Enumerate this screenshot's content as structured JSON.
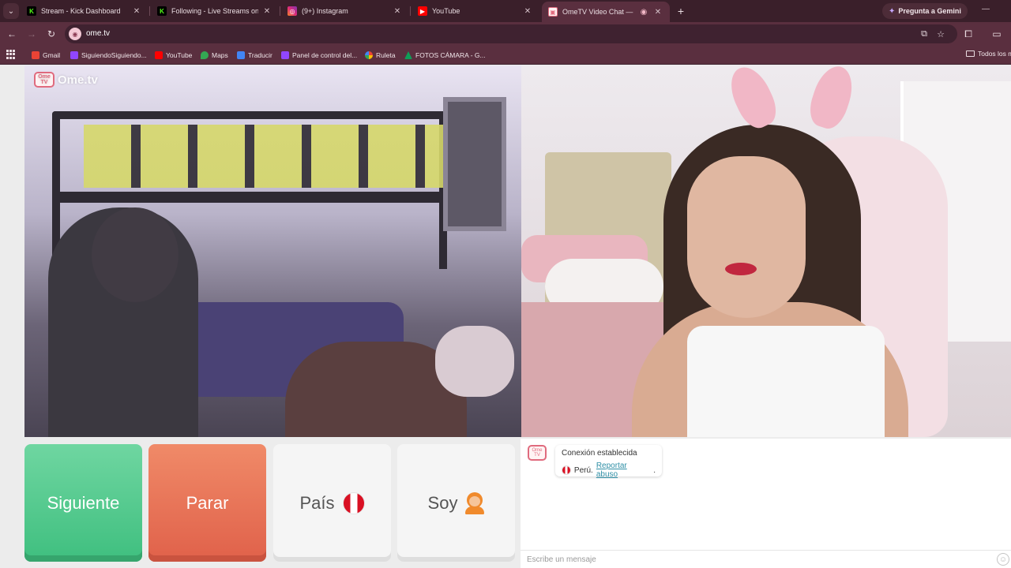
{
  "browser": {
    "tabs": [
      {
        "title": "Stream - Kick Dashboard",
        "favicon": "kick-icon",
        "color": "#53fc18",
        "active": false
      },
      {
        "title": "Following - Live Streams on Kic",
        "favicon": "kick-icon",
        "color": "#53fc18",
        "active": false
      },
      {
        "title": "(9+) Instagram",
        "favicon": "instagram-icon",
        "color": "#e1306c",
        "active": false
      },
      {
        "title": "YouTube",
        "favicon": "youtube-icon",
        "color": "#ff0000",
        "active": false
      },
      {
        "title": "OmeTV Video Chat — Ome",
        "favicon": "ometv-icon",
        "color": "#e06b7e",
        "active": true
      }
    ],
    "new_tab_glyph": "+",
    "gemini_label": "Pregunta a Gemini",
    "url": "ome.tv",
    "bookmarks": [
      {
        "label": "Gmail",
        "color": "#ea4335"
      },
      {
        "label": "SiguiendoSiguiendo...",
        "color": "#9146ff"
      },
      {
        "label": "YouTube",
        "color": "#ff0000"
      },
      {
        "label": "Maps",
        "color": "#34a853"
      },
      {
        "label": "Traducir",
        "color": "#4285f4"
      },
      {
        "label": "Panel de control del...",
        "color": "#9146ff"
      },
      {
        "label": "Ruleta",
        "color": "#fbbc05"
      },
      {
        "label": "FOTOS CÁMARA - G...",
        "color": "#0f9d58"
      }
    ],
    "all_bookmarks_label": "Todos los m"
  },
  "app": {
    "logo_text": "Ome.tv",
    "logo_badge": "Ome TV",
    "accent_color": "#e06b7e"
  },
  "controls": {
    "next_label": "Siguiente",
    "stop_label": "Parar",
    "country_label": "País",
    "country_flag": "peru-flag",
    "gender_label": "Soy",
    "gender_icon": "woman-emoji"
  },
  "chat": {
    "system_message": "Conexión establecida",
    "country_text": "Perú.",
    "report_link": "Reportar abuso",
    "report_suffix": ".",
    "input_placeholder": "Escribe un mensaje"
  }
}
